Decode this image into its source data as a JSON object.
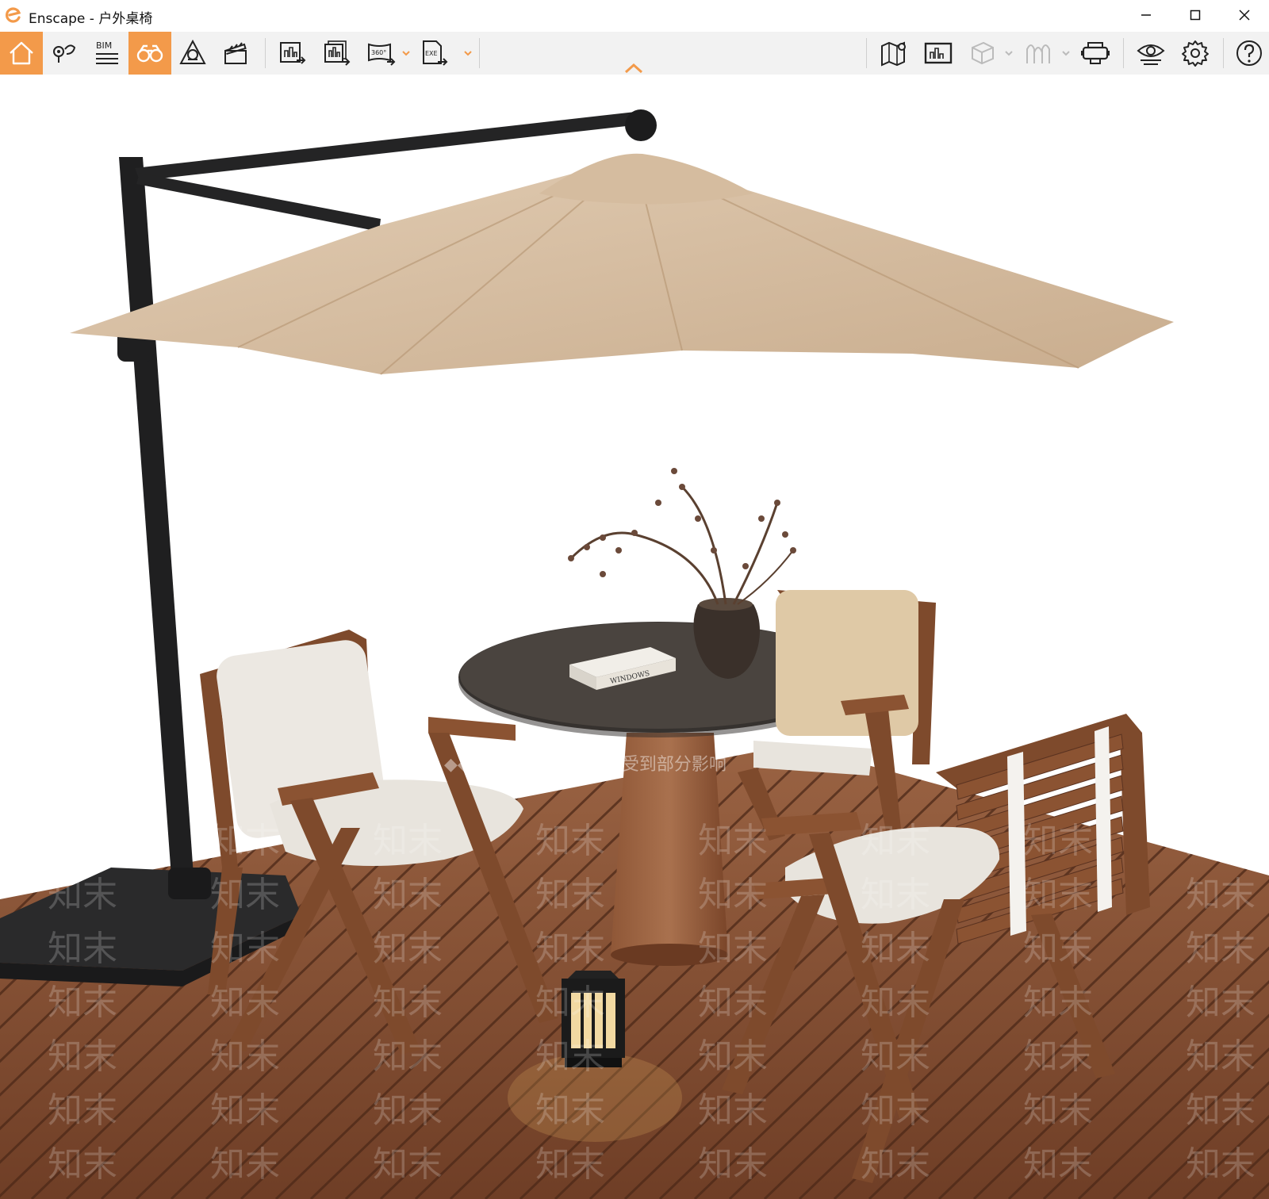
{
  "window": {
    "app_name": "Enscape",
    "separator": " - ",
    "document_name": "户外桌椅",
    "minimize_glyph": "—",
    "maximize_glyph": "☐",
    "close_glyph": "✕"
  },
  "toolbar": {
    "bim_label": "BIM",
    "pano_label": "360°",
    "exe_label": "EXE",
    "tools_left": [
      {
        "name": "home-icon",
        "active": true
      },
      {
        "name": "location-map-icon",
        "active": false
      },
      {
        "name": "bim-list-icon",
        "active": false
      },
      {
        "name": "binoculars-icon",
        "active": true
      },
      {
        "name": "atmosphere-icon",
        "active": false
      },
      {
        "name": "clapper-icon",
        "active": false
      },
      {
        "name": "export-image-icon",
        "active": false
      },
      {
        "name": "batch-export-icon",
        "active": false
      },
      {
        "name": "export-panorama-icon",
        "active": false
      },
      {
        "name": "export-exe-icon",
        "active": false
      }
    ],
    "tools_right": [
      "map-pin-icon",
      "monitor-icon",
      "cube-icon",
      "asset-library-icon",
      "vr-headset-icon",
      "eye-settings-icon",
      "gear-icon",
      "help-icon"
    ]
  },
  "watermark": {
    "banner": "◆◆ 水印保护区 画质会受到部分影响",
    "mark": "知末"
  },
  "scene_text": {
    "book_spine": "WINDOWS"
  },
  "colors": {
    "accent": "#f39a4a",
    "toolbar_bg": "#f2f2f2",
    "canopy": "#d8c0a4",
    "deck": "#8a5236",
    "wood": "#7e4a2c",
    "cushion": "#ece8e2"
  }
}
